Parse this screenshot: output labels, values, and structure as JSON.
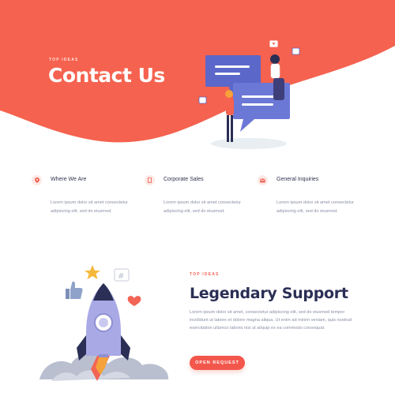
{
  "hero": {
    "eyebrow": "TOP IDEAS",
    "title": "Contact Us",
    "background_color": "#f5624f"
  },
  "info_columns": [
    {
      "icon": "map-pin-icon",
      "heading": "Where We Are",
      "text": "Lorem ipsum dolor sit amet consectetur adipiscing elit, sed do eiusmod."
    },
    {
      "icon": "phone-icon",
      "heading": "Corporate Sales",
      "text": "Lorem ipsum dolor sit amet consectetur adipiscing elit, sed do eiusmod."
    },
    {
      "icon": "mail-icon",
      "heading": "General Inquiries",
      "text": "Lorem ipsum dolor sit amet consectetur adipiscing elit, sed do eiusmod."
    }
  ],
  "support": {
    "eyebrow": "TOP IDEAS",
    "title": "Legendary Support",
    "text": "Lorem ipsum dolor sit amet, consectetur adipiscing elit, sed do eiusmod tempor incididunt ut labore et dolore magna aliqua. Ut enim ad minim veniam, quis nostrud exercitation ullamco laboris nisi ut aliquip ex ea commodo consequat.",
    "button_label": "OPEN REQUEST",
    "accent_color": "#f3574c"
  }
}
